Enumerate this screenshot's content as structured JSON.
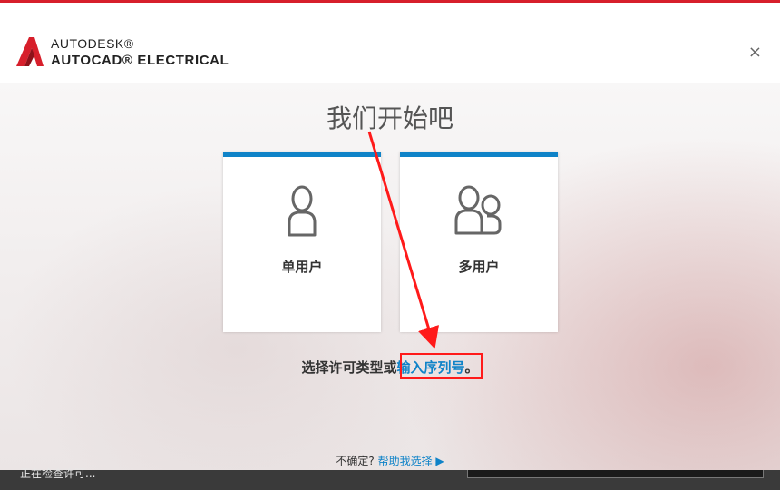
{
  "header": {
    "brand_top": "AUTODESK®",
    "brand_product": "AUTOCAD® ELECTRICAL",
    "close_label": "×"
  },
  "main": {
    "title": "我们开始吧",
    "cards": [
      {
        "label": "单用户",
        "icon": "single-user-icon"
      },
      {
        "label": "多用户",
        "icon": "multi-user-icon"
      }
    ],
    "prompt_text": "选择许可类型或",
    "serial_link": "输入序列号",
    "prompt_suffix": "。"
  },
  "footer": {
    "help_prefix": "不确定?",
    "help_link": "帮助我选择"
  },
  "status": {
    "text": "正在检查许可..."
  },
  "colors": {
    "accent": "#0f83c8",
    "brand_red": "#d71f2b",
    "annotation_red": "#ff1a1a"
  }
}
